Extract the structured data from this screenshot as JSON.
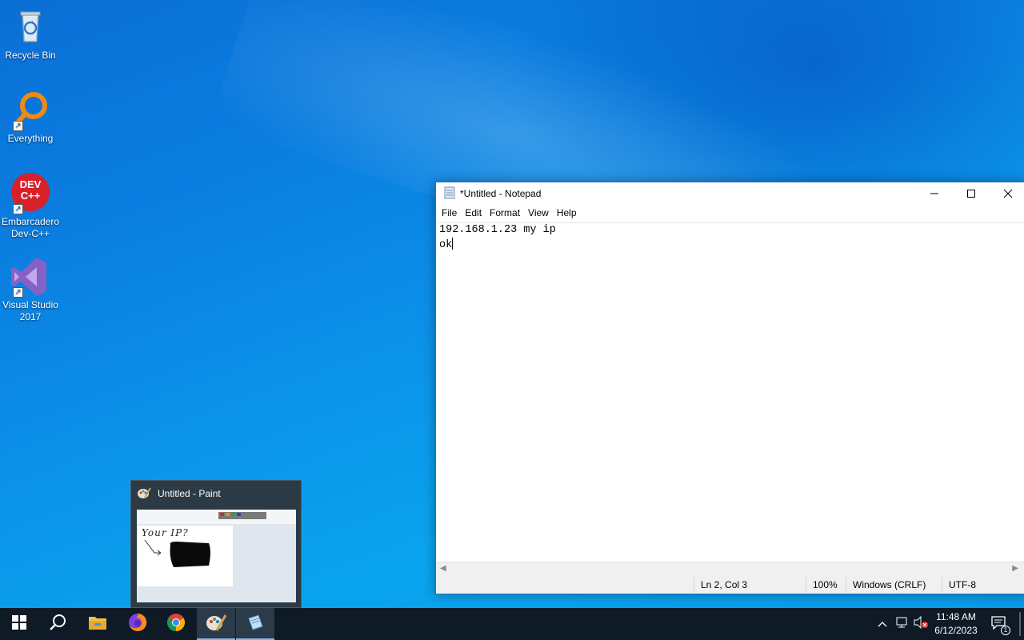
{
  "desktop": {
    "icons": [
      {
        "label": "Recycle Bin"
      },
      {
        "label": "Everything"
      },
      {
        "label": "Embarcadero Dev-C++",
        "logo_text": "DEV C++"
      },
      {
        "label": "Visual Studio 2017"
      }
    ]
  },
  "notepad": {
    "title": "*Untitled - Notepad",
    "menu": [
      "File",
      "Edit",
      "Format",
      "View",
      "Help"
    ],
    "lines": [
      "192.168.1.23 my ip",
      "ok"
    ],
    "status": {
      "position": "Ln 2, Col 3",
      "zoom": "100%",
      "line_ending": "Windows (CRLF)",
      "encoding": "UTF-8"
    }
  },
  "paint_preview": {
    "title": "Untitled - Paint",
    "sketch_text": "Your IP?"
  },
  "taskbar": {
    "apps": [
      "start-icon",
      "search-icon",
      "file-explorer-icon",
      "firefox-icon",
      "chrome-icon",
      "paint-icon",
      "notepad-icon"
    ],
    "clock_time": "11:48 AM",
    "clock_date": "6/12/2023",
    "notification_count": "1"
  },
  "colors": {
    "taskbar": "#0e1a26",
    "accent": "#2a6cc4"
  }
}
